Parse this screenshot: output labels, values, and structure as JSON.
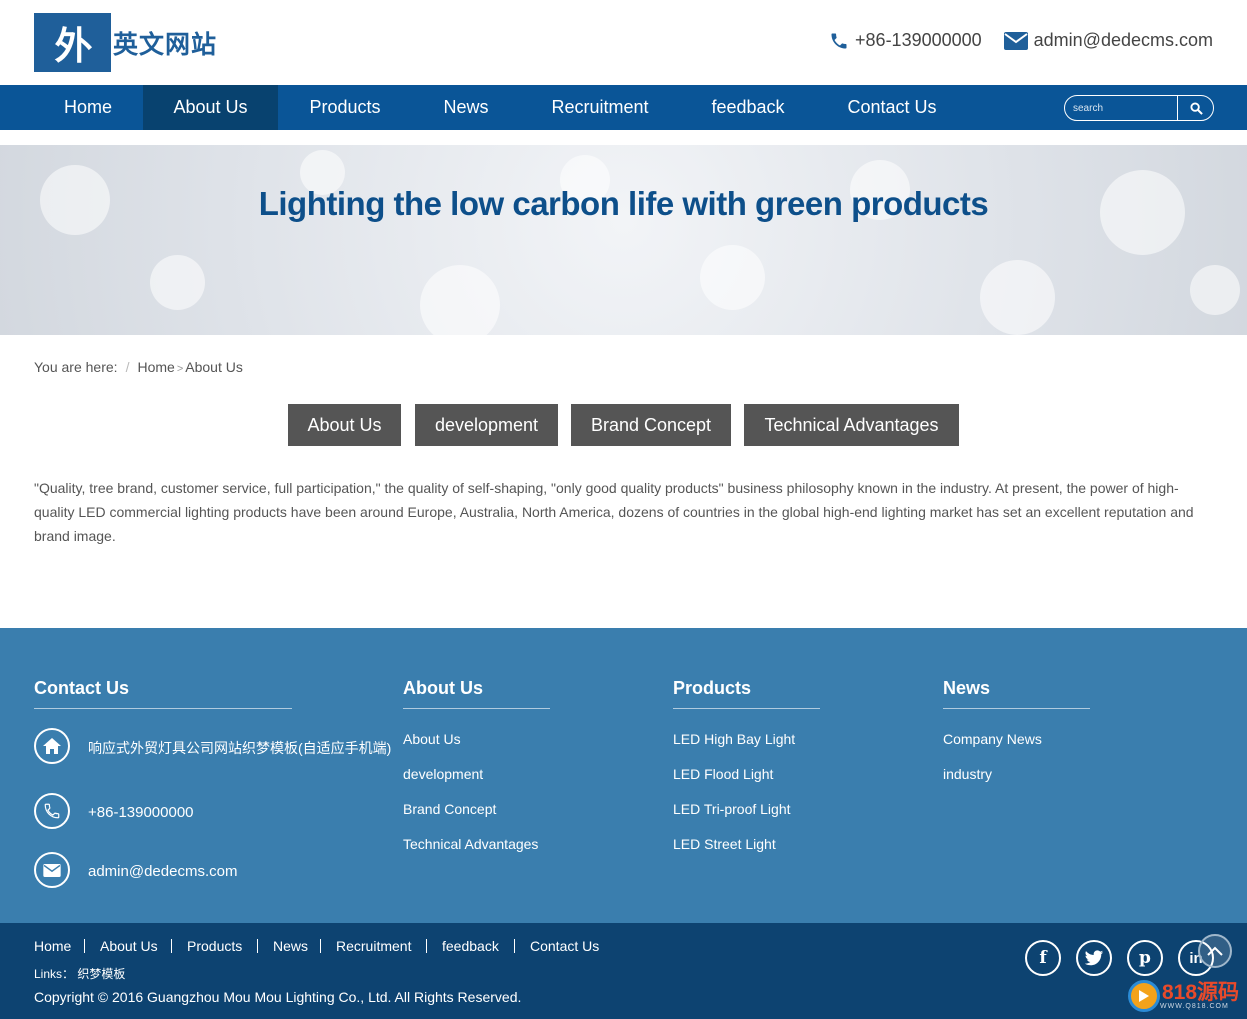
{
  "header": {
    "logo_char": "外",
    "logo_text": "英文网站",
    "phone": "+86-139000000",
    "email": "admin@dedecms.com"
  },
  "nav": {
    "items": [
      "Home",
      "About Us",
      "Products",
      "News",
      "Recruitment",
      "feedback",
      "Contact Us"
    ],
    "active": "About Us",
    "search_placeholder": "search"
  },
  "banner": {
    "title": "Lighting the low carbon life with green products"
  },
  "breadcrumb": {
    "prefix": "You are here:",
    "home": "Home",
    "current": "About Us",
    "gt": ">",
    "sep": "/"
  },
  "subtabs": [
    "About Us",
    "development",
    "Brand Concept",
    "Technical Advantages"
  ],
  "content": {
    "paragraph": "\"Quality, tree brand, customer service, full participation,\" the quality of self-shaping, \"only good quality products\" business philosophy known in the industry. At present, the power of high-quality LED commercial lighting products have been around Europe, Australia, North America, dozens of countries in the global high-end lighting market has set an excellent reputation and brand image."
  },
  "footer": {
    "contact": {
      "title": "Contact Us",
      "address": "响应式外贸灯具公司网站织梦模板(自适应手机端)",
      "phone": "+86-139000000",
      "email": "admin@dedecms.com"
    },
    "about": {
      "title": "About Us",
      "links": [
        "About Us",
        "development",
        "Brand Concept",
        "Technical Advantages"
      ]
    },
    "products": {
      "title": "Products",
      "links": [
        "LED High Bay Light",
        "LED Flood Light",
        "LED Tri-proof Light",
        "LED Street Light"
      ]
    },
    "news": {
      "title": "News",
      "links": [
        "Company News",
        "industry"
      ]
    }
  },
  "bottom": {
    "nav": [
      "Home",
      "About Us",
      "Products",
      "News",
      "Recruitment",
      "feedback",
      "Contact Us"
    ],
    "links_label": "Links：",
    "links_value": "织梦模板",
    "copyright": "Copyright © 2016 Guangzhou Mou Mou Lighting Co., Ltd. All Rights Reserved.",
    "social": [
      "f",
      "twitter",
      "p",
      "in"
    ]
  },
  "watermark": {
    "text": "818源码",
    "sub": "WWW.Q818.COM"
  },
  "colors": {
    "nav_bg": "#0a5597",
    "nav_active": "#08426f",
    "footer_bg": "#3a7eae",
    "bottom_bg": "#0d4371",
    "subtab_bg": "#555555",
    "banner_title": "#0d4f8a"
  }
}
